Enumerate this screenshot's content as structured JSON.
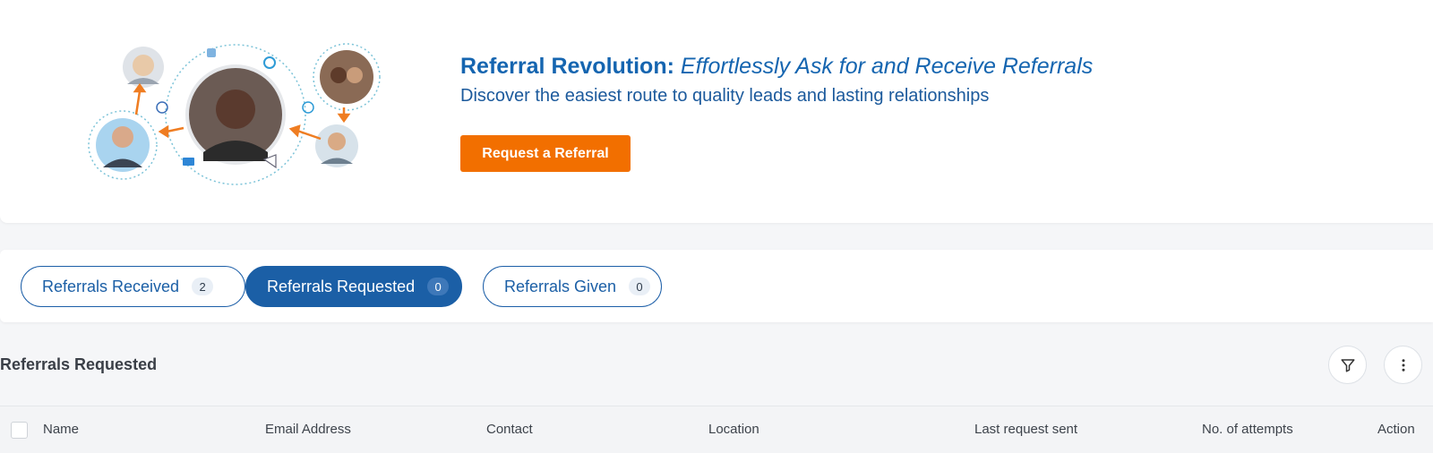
{
  "hero": {
    "title_bold": "Referral Revolution:",
    "title_italic": "Effortlessly Ask for and Receive Referrals",
    "subtitle": "Discover the easiest route to quality leads and lasting relationships",
    "cta_label": "Request a Referral"
  },
  "tabs": [
    {
      "label": "Referrals Received",
      "count": "2",
      "active": false
    },
    {
      "label": "Referrals Requested",
      "count": "0",
      "active": true
    },
    {
      "label": "Referrals Given",
      "count": "0",
      "active": false
    }
  ],
  "section": {
    "title": "Referrals Requested",
    "filter_icon": "filter-icon",
    "more_icon": "more-vertical-icon"
  },
  "table": {
    "columns": [
      "Name",
      "Email Address",
      "Contact",
      "Location",
      "Last request sent",
      "No. of attempts",
      "Action"
    ]
  },
  "colors": {
    "brand_blue": "#1b5fa6",
    "accent_orange": "#f26f00"
  }
}
